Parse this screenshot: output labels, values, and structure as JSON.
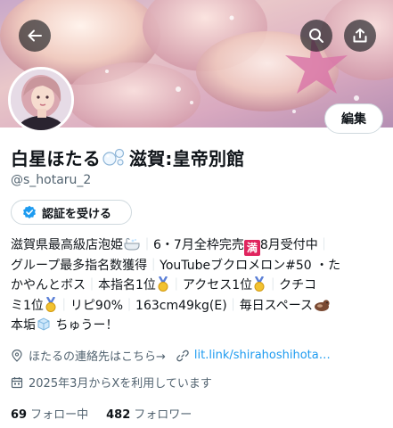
{
  "profile": {
    "name_part1": "白星ほたる",
    "name_part2": "滋賀:皇帝別館",
    "handle": "@s_hotaru_2",
    "edit_label": "編集",
    "verify_label": "認証を受ける"
  },
  "bio": {
    "l1a": "滋賀県最高級店泡姫",
    "l1b": "6・7月全枠完売",
    "l1c": "満",
    "l1d": "8月受付中",
    "l2a": "グループ最多指名数獲得",
    "l2b": "YouTubeブクロメロン#50 ・た",
    "l3a": "かやんとボス",
    "l3b": "本指名1位",
    "l3c": "アクセス1位",
    "l3d": "クチコ",
    "l4a": "ミ1位",
    "l4b": "リピ90%",
    "l4c": "163cm49kg(E)",
    "l4d": "毎日スペース",
    "l5a": "本垢",
    "l5b": "ちゅうー！"
  },
  "info": {
    "contact_text": "ほたるの連絡先はこちら→",
    "link_text": "lit.link/shirahoshihota…",
    "joined_text": "2025年3月からXを利用しています"
  },
  "stats": {
    "following_count": "69",
    "following_label": "フォロー中",
    "followers_count": "482",
    "followers_label": "フォロワー"
  },
  "icons": {
    "back": "back-arrow-icon",
    "search": "search-icon",
    "share": "share-icon",
    "verified": "verified-badge-icon",
    "location": "location-pin-icon",
    "link": "link-icon",
    "calendar": "calendar-icon"
  },
  "colors": {
    "link": "#1d9bf0",
    "secondary_text": "#536471",
    "primary_text": "#0f1419",
    "border": "#cfd9de"
  }
}
